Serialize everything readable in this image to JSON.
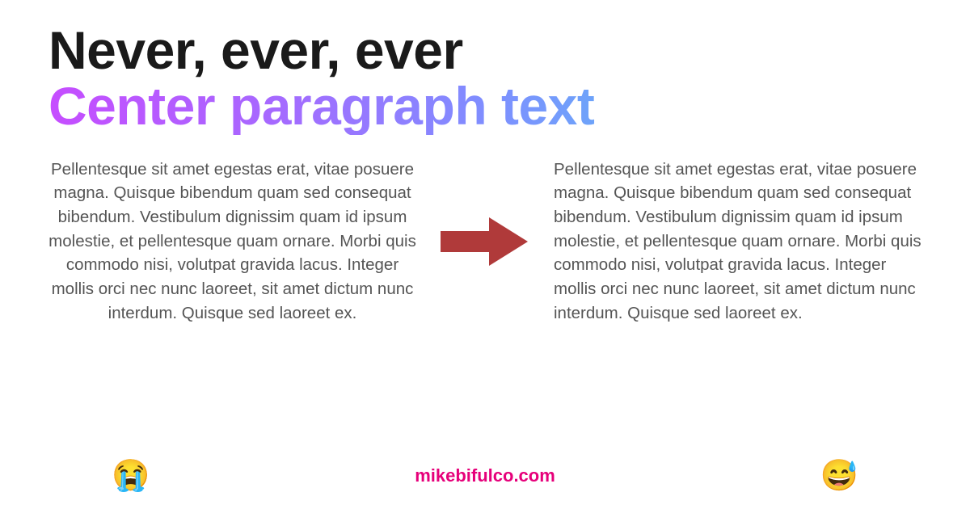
{
  "heading": {
    "line1": "Never, ever, ever",
    "line2": "Center paragraph text"
  },
  "leftParagraph": "Pellentesque sit amet egestas erat, vitae posuere magna. Quisque bibendum quam sed consequat bibendum. Vestibulum dignissim quam id ipsum molestie, et pellentesque quam ornare. Morbi quis commodo nisi, volutpat gravida lacus. Integer mollis orci nec nunc laoreet, sit amet dictum nunc interdum. Quisque sed laoreet ex.",
  "rightParagraph": "Pellentesque sit amet egestas erat, vitae posuere magna. Quisque bibendum quam sed consequat bibendum. Vestibulum dignissim quam id ipsum molestie, et pellentesque quam ornare. Morbi quis commodo nisi, volutpat gravida lacus. Integer mollis orci nec nunc laoreet, sit amet dictum nunc interdum. Quisque sed laoreet ex.",
  "emoji": {
    "crying": "😭",
    "sweatSmile": "😅"
  },
  "site": "mikebifulco.com",
  "colors": {
    "arrow": "#b03a3a",
    "link": "#e6007a"
  }
}
